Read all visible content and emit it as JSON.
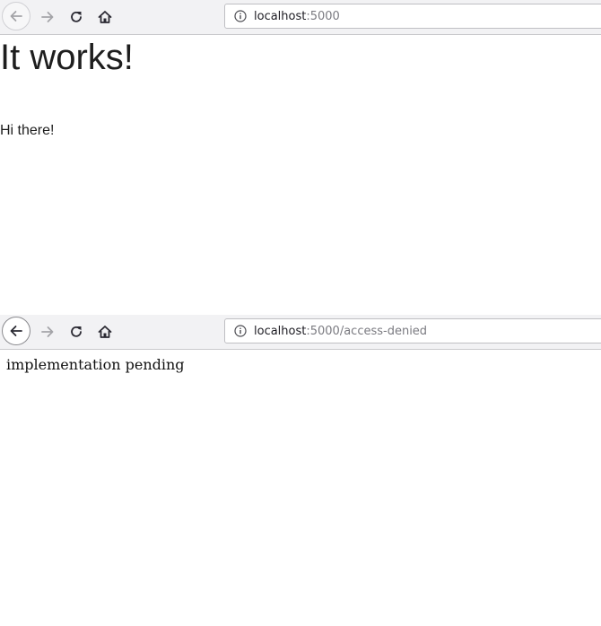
{
  "windows": [
    {
      "toolbar": {
        "back_icon": "arrow-left-icon",
        "forward_icon": "arrow-right-icon",
        "reload_icon": "reload-icon",
        "home_icon": "home-icon",
        "info_icon": "info-icon",
        "url_host": "localhost",
        "url_path": ":5000"
      },
      "page": {
        "heading": "It works!",
        "paragraph": "Hi there!"
      }
    },
    {
      "toolbar": {
        "back_icon": "arrow-left-icon",
        "forward_icon": "arrow-right-icon",
        "reload_icon": "reload-icon",
        "home_icon": "home-icon",
        "info_icon": "info-icon",
        "url_host": "localhost",
        "url_path": ":5000/access-denied"
      },
      "page": {
        "paragraph": "implementation pending"
      }
    }
  ],
  "colors": {
    "toolbar_bg": "#f2f2f4",
    "urlbar_border": "#bfbfc3",
    "disabled_icon": "#a4a4a8",
    "active_icon": "#2b2a33"
  }
}
